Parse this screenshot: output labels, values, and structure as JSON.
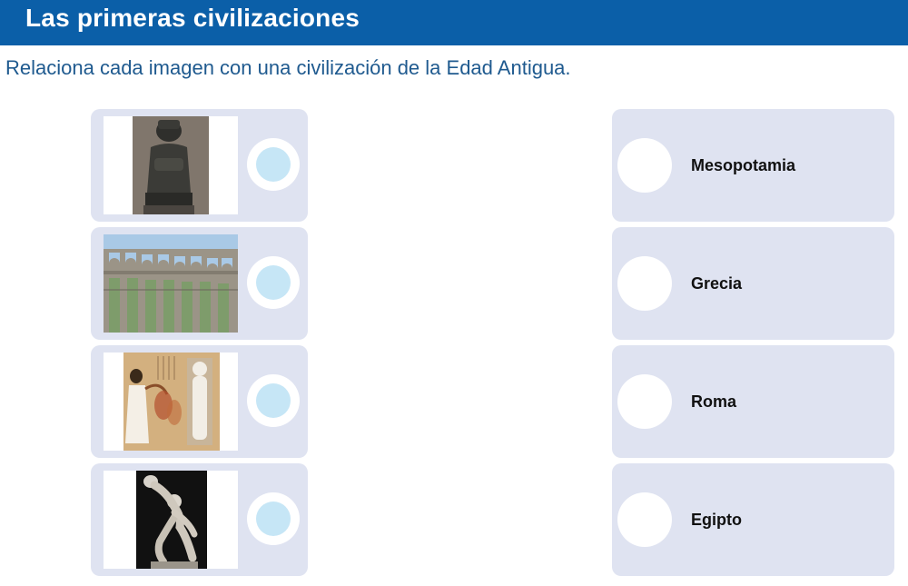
{
  "header": {
    "title": "Las primeras civilizaciones"
  },
  "instructions": "Relaciona cada imagen con una civilización de la Edad Antigua.",
  "images": [
    {
      "icon": "mesopotamian-statue-image"
    },
    {
      "icon": "roman-aqueduct-image"
    },
    {
      "icon": "egyptian-papyrus-image"
    },
    {
      "icon": "greek-discobolus-image"
    }
  ],
  "answers": [
    {
      "label": "Mesopotamia"
    },
    {
      "label": "Grecia"
    },
    {
      "label": "Roma"
    },
    {
      "label": "Egipto"
    }
  ],
  "colors": {
    "header_bg": "#0b5fa8",
    "instruction_text": "#1f5a8f",
    "card_bg": "#dfe3f1",
    "dot_fill": "#c6e6f6"
  }
}
